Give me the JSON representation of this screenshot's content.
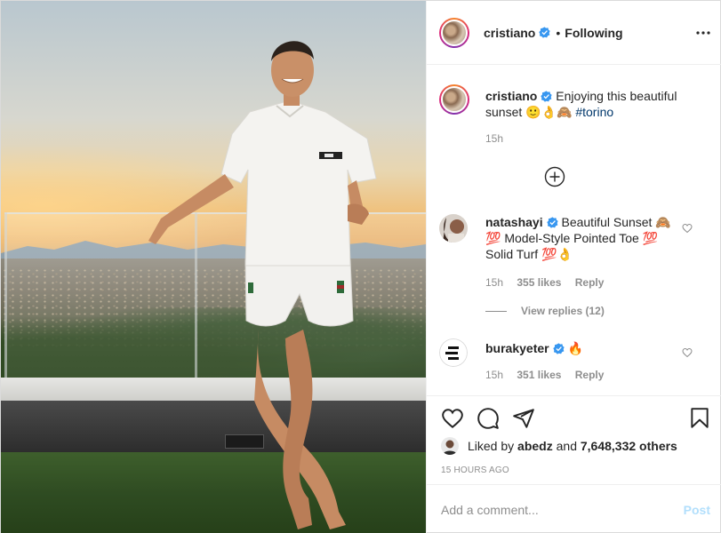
{
  "header": {
    "username": "cristiano",
    "separator": "•",
    "follow_status": "Following",
    "more_icon": "more-horizontal-icon"
  },
  "caption": {
    "username": "cristiano",
    "text": "Enjoying this beautiful sunset 🙂👌🙈",
    "hashtag": "#torino",
    "time": "15h"
  },
  "load_more_icon": "plus-circle-icon",
  "comments": [
    {
      "username": "natashayi",
      "text": "Beautiful Sunset 🙈 💯 Model-Style Pointed Toe 💯 Solid Turf 💯👌",
      "time": "15h",
      "likes": "355 likes",
      "reply": "Reply",
      "view_replies": "View replies (12)"
    },
    {
      "username": "burakyeter",
      "text": "🔥",
      "time": "15h",
      "likes": "351 likes",
      "reply": "Reply"
    }
  ],
  "actions": {
    "like_icon": "heart-icon",
    "comment_icon": "comment-icon",
    "share_icon": "send-icon",
    "save_icon": "bookmark-icon"
  },
  "likes_summary": {
    "prefix": "Liked by",
    "user": "abedz",
    "middle": "and",
    "count": "7,648,332 others"
  },
  "post_time": "15 HOURS AGO",
  "add_comment": {
    "placeholder": "Add a comment...",
    "post_label": "Post"
  },
  "colors": {
    "verified": "#3897f0",
    "link": "#00376b",
    "muted": "#8e8e8e",
    "post_disabled": "#b2dffc",
    "border": "#efefef"
  }
}
